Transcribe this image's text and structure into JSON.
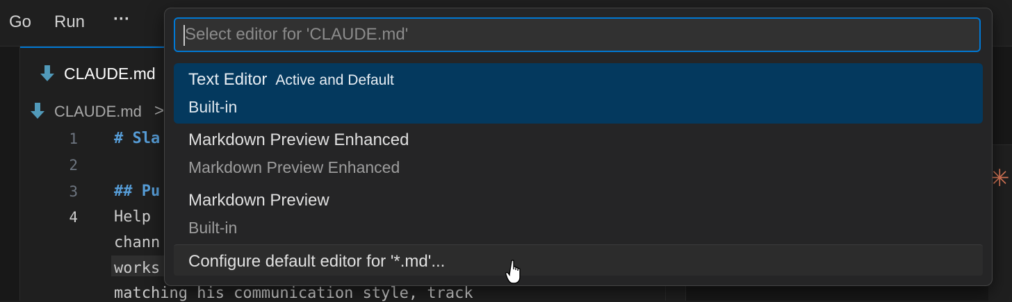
{
  "menubar": {
    "items": [
      "Go",
      "Run",
      "···"
    ]
  },
  "editor": {
    "tab_label": "CLAUDE.md",
    "breadcrumb_file": "CLAUDE.md",
    "breadcrumb_sep": ">",
    "line_numbers": [
      "1",
      "2",
      "3",
      "4"
    ],
    "lines": [
      {
        "text": "# Sla",
        "heading": true
      },
      {
        "text": "",
        "heading": false
      },
      {
        "text": "## Pu",
        "heading": true
      },
      {
        "text": "Help",
        "heading": false
      },
      {
        "text": "chann",
        "heading": false
      },
      {
        "text": "works",
        "heading": false
      },
      {
        "text": "matching his communication style, track",
        "heading": false
      }
    ]
  },
  "quick_pick": {
    "placeholder": "Select editor for 'CLAUDE.md'",
    "items": [
      {
        "label": "Text Editor",
        "description": "Active and Default",
        "detail": "Built-in",
        "selected": true
      },
      {
        "label": "Markdown Preview Enhanced",
        "description": "",
        "detail": "Markdown Preview Enhanced",
        "selected": false
      },
      {
        "label": "Markdown Preview",
        "description": "",
        "detail": "Built-in",
        "selected": false
      }
    ],
    "configure_label": "Configure default editor for '*.md'..."
  },
  "colors": {
    "accent": "#0078d4",
    "selected_bg": "#04395e",
    "markdown_icon": "#519aba",
    "claude_icon": "#d97757"
  },
  "icons": {
    "file": "markdown-icon",
    "claude": "sparkle-icon",
    "more": "ellipsis-icon",
    "pointer": "hand-pointer-icon"
  }
}
